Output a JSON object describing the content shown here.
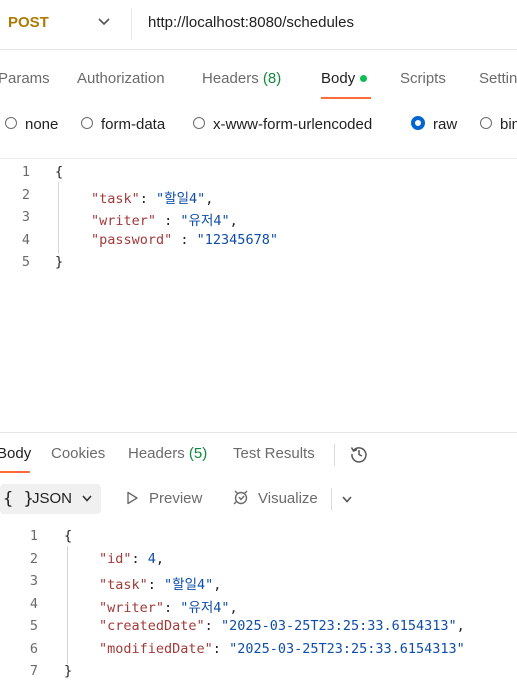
{
  "request": {
    "method": "POST",
    "url": "http://localhost:8080/schedules"
  },
  "request_tabs": {
    "params": "Params",
    "authorization": "Authorization",
    "headers": "Headers",
    "headers_count": "(8)",
    "body": "Body",
    "scripts": "Scripts",
    "settings": "Settin"
  },
  "body_types": {
    "none": "none",
    "form_data": "form-data",
    "urlencoded": "x-www-form-urlencoded",
    "raw": "raw",
    "binary": "bin",
    "selected": "raw"
  },
  "request_body": {
    "line_numbers": [
      "1",
      "2",
      "3",
      "4",
      "5"
    ],
    "open_brace": "{",
    "close_brace": "}",
    "fields": [
      {
        "key": "\"task\"",
        "sep": ": ",
        "value": "\"할일4\"",
        "trail": ","
      },
      {
        "key": "\"writer\"",
        "sep": " : ",
        "value": "\"유저4\"",
        "trail": ","
      },
      {
        "key": "\"password\"",
        "sep": " : ",
        "value": "\"12345678\"",
        "trail": ""
      }
    ]
  },
  "response_tabs": {
    "body": "Body",
    "cookies": "Cookies",
    "headers": "Headers",
    "headers_count": "(5)",
    "test_results": "Test Results"
  },
  "response_toolbar": {
    "format_icon": "{ }",
    "format": "JSON",
    "preview": "Preview",
    "visualize": "Visualize"
  },
  "response_body": {
    "line_numbers": [
      "1",
      "2",
      "3",
      "4",
      "5",
      "6",
      "7"
    ],
    "open_brace": "{",
    "close_brace": "}",
    "fields": [
      {
        "key": "\"id\"",
        "sep": ": ",
        "value": "4",
        "trail": ","
      },
      {
        "key": "\"task\"",
        "sep": ": ",
        "value": "\"할일4\"",
        "trail": ","
      },
      {
        "key": "\"writer\"",
        "sep": ": ",
        "value": "\"유저4\"",
        "trail": ","
      },
      {
        "key": "\"createdDate\"",
        "sep": ": ",
        "value": "\"2025-03-25T23:25:33.6154313\"",
        "trail": ","
      },
      {
        "key": "\"modifiedDate\"",
        "sep": ": ",
        "value": "\"2025-03-25T23:25:33.6154313\"",
        "trail": ""
      }
    ]
  },
  "colors": {
    "method": "#ad7a03",
    "accent": "#ff6c37",
    "active_dot": "#0cbb52",
    "count": "#0f8a3b",
    "radio_selected": "#0265d2",
    "json_key": "#a33a3a",
    "json_value": "#0f4ea8"
  },
  "icons": {
    "method_dropdown": "chevron-down-icon",
    "history": "history-icon",
    "format_dropdown": "chevron-down-icon",
    "preview": "play-icon",
    "visualize": "visualize-icon",
    "more": "chevron-down-icon"
  }
}
